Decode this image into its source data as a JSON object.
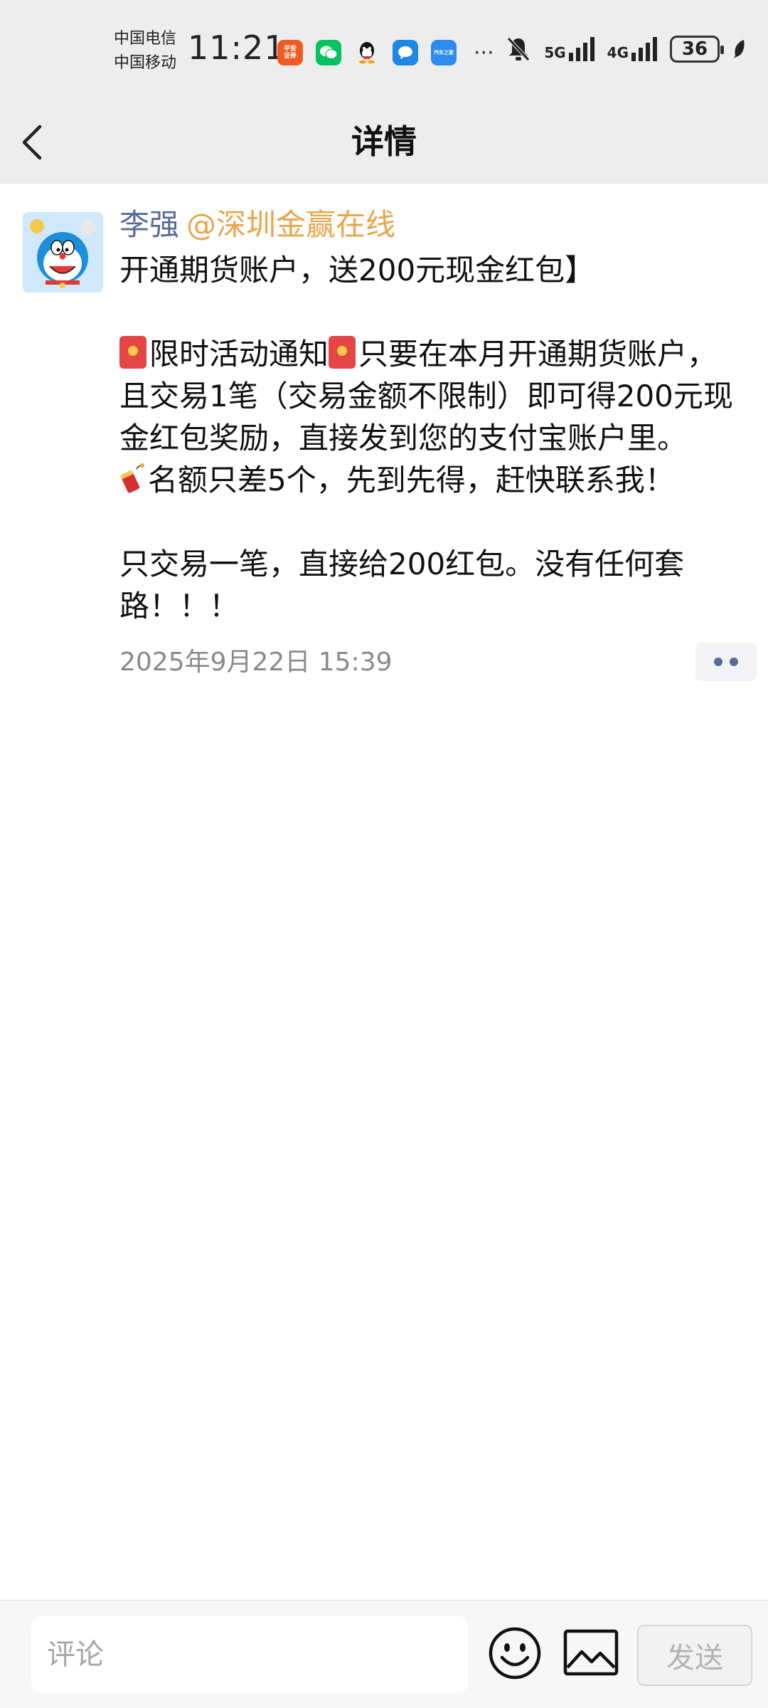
{
  "status_bar": {
    "carrier_1": "中国电信",
    "carrier_2": "中国移动",
    "time": "11:21",
    "app_icons": [
      "pingan-securities-icon",
      "wechat-icon",
      "qq-icon",
      "messages-icon",
      "autohome-icon"
    ],
    "pingan_text": "平安证券",
    "autohome_text": "汽车之家",
    "more": "···",
    "network_1": "5G",
    "network_2": "4G",
    "battery": "36"
  },
  "nav": {
    "title": "详情"
  },
  "post": {
    "author": "李强",
    "mention": "@深圳金赢在线",
    "line_1": "开通期货账户，送200元现金红包】",
    "para_2_part_a": "限时活动通知",
    "para_2_part_b": "只要在本月开通期货账户，且交易1笔（交易金额不限制）即可得200元现金红包奖励，直接发到您的支付宝账户里。",
    "para_3": "名额只差5个，先到先得，赶快联系我！",
    "para_4": "只交易一笔，直接给200红包。没有任何套路！！！",
    "timestamp": "2025年9月22日 15:39"
  },
  "comment_bar": {
    "placeholder": "评论",
    "send_label": "发送"
  },
  "colors": {
    "link_blue": "#576b95",
    "mention_orange": "#e8a54b",
    "header_bg": "#ededed"
  }
}
